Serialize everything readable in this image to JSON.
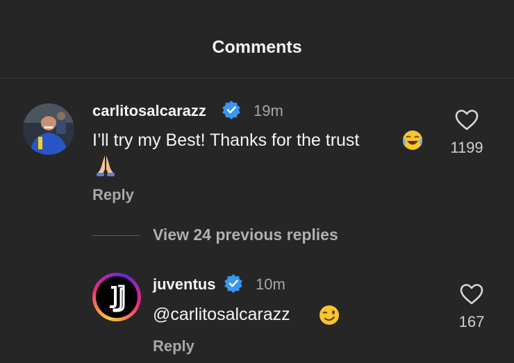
{
  "header": {
    "title": "Comments"
  },
  "comments": [
    {
      "username": "carlitosalcarazz",
      "verified": true,
      "time": "19m",
      "text": "I’ll try my Best! Thanks for the trust",
      "likes": "1199",
      "reply_label": "Reply"
    }
  ],
  "thread": {
    "view_previous_label": "View 24 previous replies",
    "replies": [
      {
        "username": "juventus",
        "verified": true,
        "time": "10m",
        "text": "@carlitosalcarazz",
        "likes": "167",
        "reply_label": "Reply"
      }
    ]
  },
  "icons": {
    "verified_color": "#3897f0",
    "heart": "heart-icon",
    "laughing_emoji": "face-with-tears-of-joy",
    "praying_emoji": "folded-hands",
    "wink_emoji": "winking-face"
  }
}
